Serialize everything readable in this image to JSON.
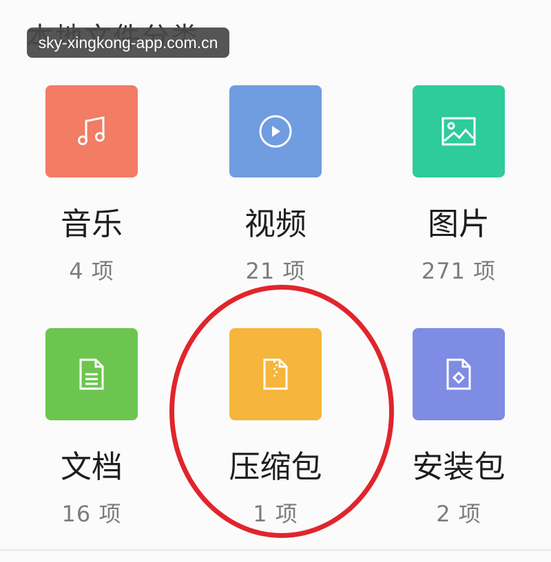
{
  "header": {
    "section_title": "本地文件分类"
  },
  "watermark": {
    "text": "sky-xingkong-app.com.cn"
  },
  "categories": [
    {
      "label": "音乐",
      "count": "4 项",
      "color": "#f27c64",
      "icon": "music-note-icon"
    },
    {
      "label": "视频",
      "count": "21 项",
      "color": "#6f9de0",
      "icon": "play-circle-icon"
    },
    {
      "label": "图片",
      "count": "271 项",
      "color": "#2ecc9b",
      "icon": "image-icon"
    },
    {
      "label": "文档",
      "count": "16 项",
      "color": "#6cc54e",
      "icon": "document-icon"
    },
    {
      "label": "压缩包",
      "count": "1 项",
      "color": "#f6b53b",
      "icon": "zip-file-icon"
    },
    {
      "label": "安装包",
      "count": "2 项",
      "color": "#7f8ce3",
      "icon": "apk-package-icon"
    }
  ],
  "annotation": {
    "color": "#e0252c",
    "highlighted": "压缩包"
  }
}
